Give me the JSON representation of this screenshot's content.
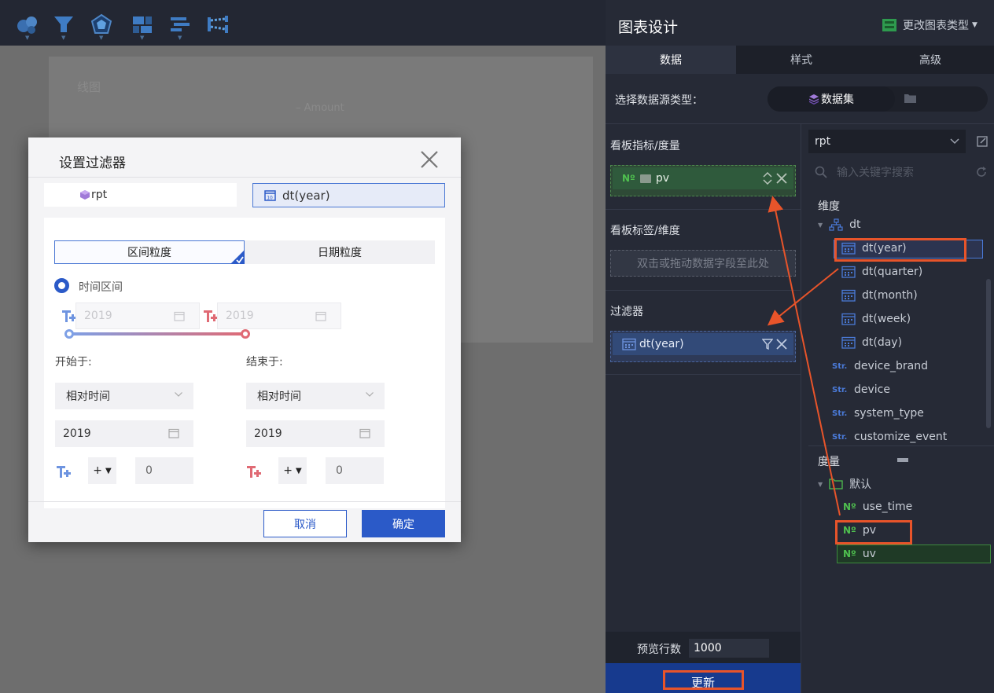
{
  "chart": {
    "title": "线图",
    "legend": "Amount"
  },
  "dialog": {
    "title": "设置过滤器",
    "source": "rpt",
    "dimension": "dt(year)",
    "tabs": {
      "range": "区间粒度",
      "date": "日期粒度"
    },
    "radio_label": "时间区间",
    "range_start_placeholder": "2019",
    "range_end_placeholder": "2019",
    "start_label": "开始于:",
    "end_label": "结束于:",
    "start_mode": "相对时间",
    "end_mode": "相对时间",
    "start_value": "2019",
    "end_value": "2019",
    "start_op": "+",
    "end_op": "+",
    "start_offset": "0",
    "end_offset": "0",
    "cancel_label": "取消",
    "ok_label": "确定"
  },
  "panel": {
    "title": "图表设计",
    "change_type": "更改图表类型",
    "tabs": [
      "数据",
      "样式",
      "高级"
    ],
    "ds_type_label": "选择数据源类型：",
    "ds_type_value": "数据集",
    "measure_section": "看板指标/度量",
    "measure_chip": "pv",
    "dim_section": "看板标签/维度",
    "dim_placeholder": "双击或拖动数据字段至此处",
    "filter_section": "过滤器",
    "filter_chip": "dt(year)",
    "preview_label": "预览行数",
    "preview_value": "1000",
    "update_label": "更新"
  },
  "fields": {
    "dataset": "rpt",
    "search_placeholder": "输入关键字搜索",
    "dim_head": "维度",
    "dim_group": "dt",
    "dt_items": [
      "dt(year)",
      "dt(quarter)",
      "dt(month)",
      "dt(week)",
      "dt(day)"
    ],
    "str_tag": "Str.",
    "str_items": [
      "device_brand",
      "device",
      "system_type",
      "customize_event"
    ],
    "measure_head": "度量",
    "measure_group": "默认",
    "num_tag": "Nº",
    "num_items": [
      "use_time",
      "pv",
      "uv"
    ]
  },
  "colors": {
    "accent": "#2b5ac8",
    "annotation": "#e8542a",
    "measure_green": "#4fc04f"
  }
}
